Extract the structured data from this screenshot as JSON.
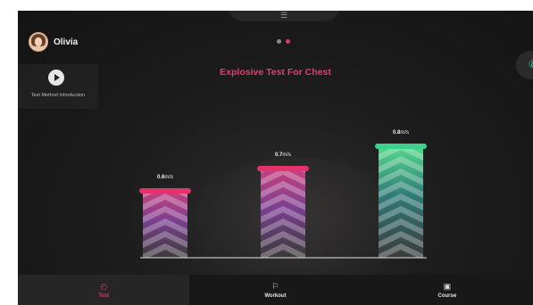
{
  "user": {
    "name": "Olivia",
    "avatar_icon": "avatar-icon"
  },
  "pager": {
    "total": 2,
    "active_index": 1
  },
  "intro": {
    "label": "Test Method Introduction",
    "icon": "play-icon"
  },
  "call": {
    "icon": "phone-icon"
  },
  "title": "Explosive Test For Chest",
  "colors": {
    "accent": "#e2336b",
    "title": "#e83a72",
    "green": "#39c08a"
  },
  "chart_data": {
    "type": "bar",
    "unit": "m/s",
    "values": [
      0.6,
      0.7,
      0.8
    ],
    "value_labels": [
      "0.6",
      "0.7",
      "0.8"
    ],
    "bar_colors": [
      [
        "#e2336b",
        "#7a3f8f"
      ],
      [
        "#e2336b",
        "#7a3f8f"
      ],
      [
        "#3fd08e",
        "#2f7a78"
      ]
    ],
    "ylim": [
      0,
      1.0
    ]
  },
  "tabs": [
    {
      "label": "Test",
      "icon": "stopwatch-icon",
      "active": true
    },
    {
      "label": "Workout",
      "icon": "flag-icon",
      "active": false
    },
    {
      "label": "Course",
      "icon": "play-square-icon",
      "active": false
    }
  ]
}
